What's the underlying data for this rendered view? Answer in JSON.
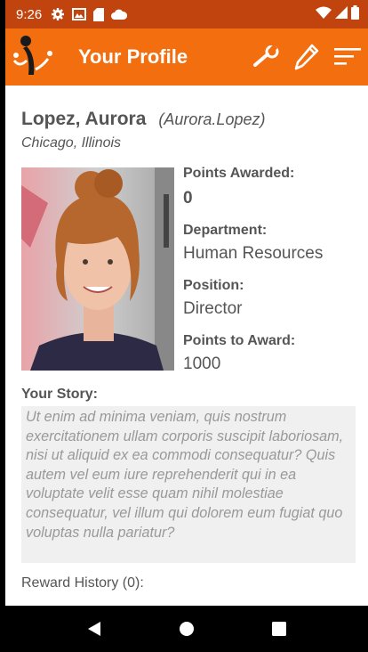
{
  "status_bar": {
    "time": "9:26",
    "icons": [
      "gear-icon",
      "photo-icon",
      "sd-card-icon",
      "cloud-icon",
      "wifi-icon",
      "signal-icon",
      "battery-icon"
    ]
  },
  "app_bar": {
    "title": "Your Profile",
    "actions": [
      "wrench-icon",
      "pencil-icon",
      "sort-icon"
    ],
    "colors": {
      "bar": "#f26e0f",
      "status": "#c1440e"
    }
  },
  "profile": {
    "name": "Lopez, Aurora",
    "username": "(Aurora.Lopez)",
    "location": "Chicago, Illinois",
    "fields": [
      {
        "label": "Points Awarded:",
        "value": "0"
      },
      {
        "label": "Department:",
        "value": "Human Resources"
      },
      {
        "label": "Position:",
        "value": "Director"
      },
      {
        "label": "Points to Award:",
        "value": "1000"
      }
    ],
    "story_label": "Your Story:",
    "story": "Ut enim ad minima veniam, quis nostrum exercitationem ullam corporis suscipit laboriosam, nisi ut aliquid ex ea commodi consequatur? Quis autem vel eum iure reprehenderit qui in ea voluptate velit esse quam nihil molestiae consequatur, vel illum qui dolorem eum fugiat quo voluptas nulla pariatur?",
    "reward_history": "Reward History (0):"
  },
  "nav": {
    "buttons": [
      "back-icon",
      "home-icon",
      "recents-icon"
    ]
  }
}
